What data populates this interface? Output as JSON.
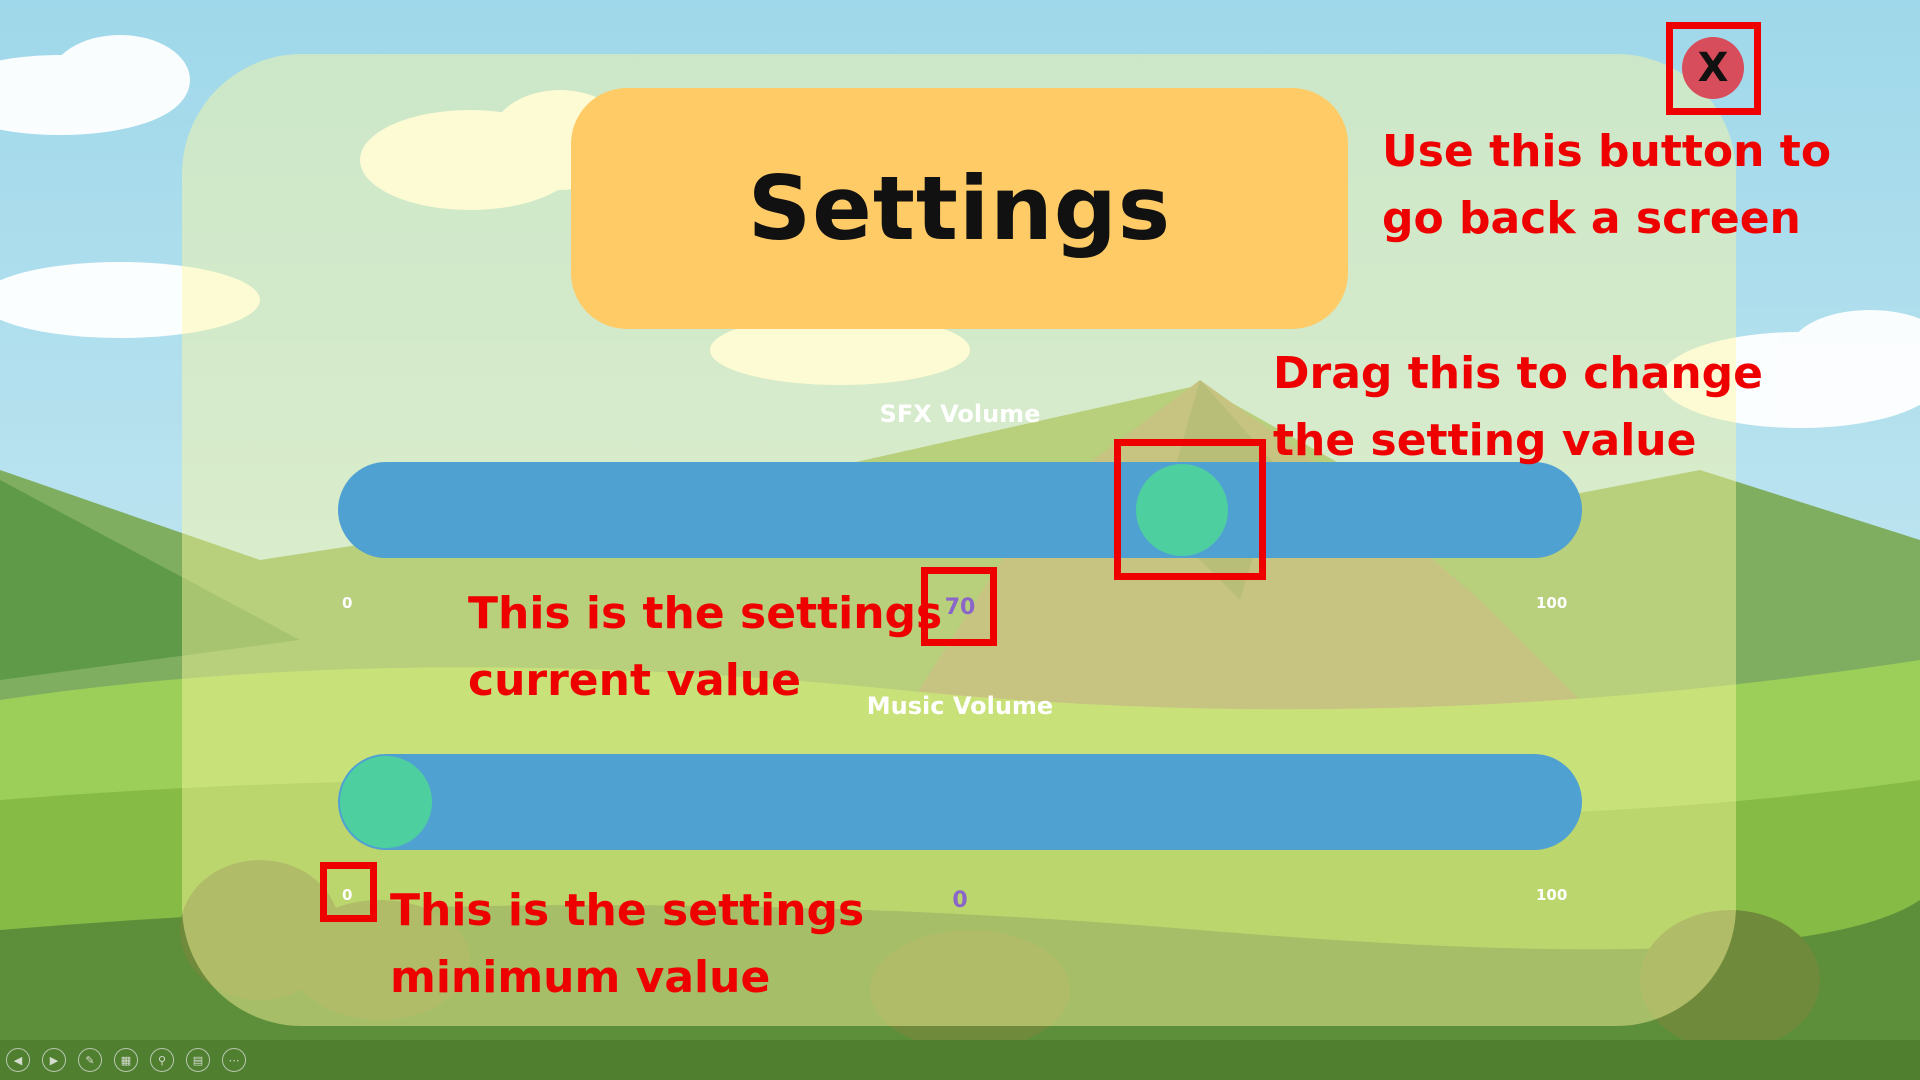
{
  "title": "Settings",
  "close_button": {
    "label": "X"
  },
  "sliders": [
    {
      "label": "SFX Volume",
      "min_label": "0",
      "max_label": "100",
      "value_label": "70",
      "value": 0.7
    },
    {
      "label": "Music Volume",
      "min_label": "0",
      "max_label": "100",
      "value_label": "0",
      "value": 0.0
    }
  ],
  "annotations": {
    "close": [
      "Use this button to",
      "go back a screen"
    ],
    "drag": [
      "Drag this to change",
      "the setting value"
    ],
    "current": [
      "This is the settings",
      "current value"
    ],
    "minimum": [
      "This is the settings",
      "minimum value"
    ]
  },
  "toolbar": [
    "previous-icon",
    "next-icon",
    "pen-icon",
    "slides-icon",
    "zoom-icon",
    "subtitles-icon",
    "more-icon"
  ],
  "colors": {
    "track": "#4fa1d2",
    "knob": "#4ecf9f",
    "title_bg": "#fecb66",
    "close_bg": "#d84d5b",
    "value_text": "#8a66c9",
    "annotation": "#ee0000"
  }
}
